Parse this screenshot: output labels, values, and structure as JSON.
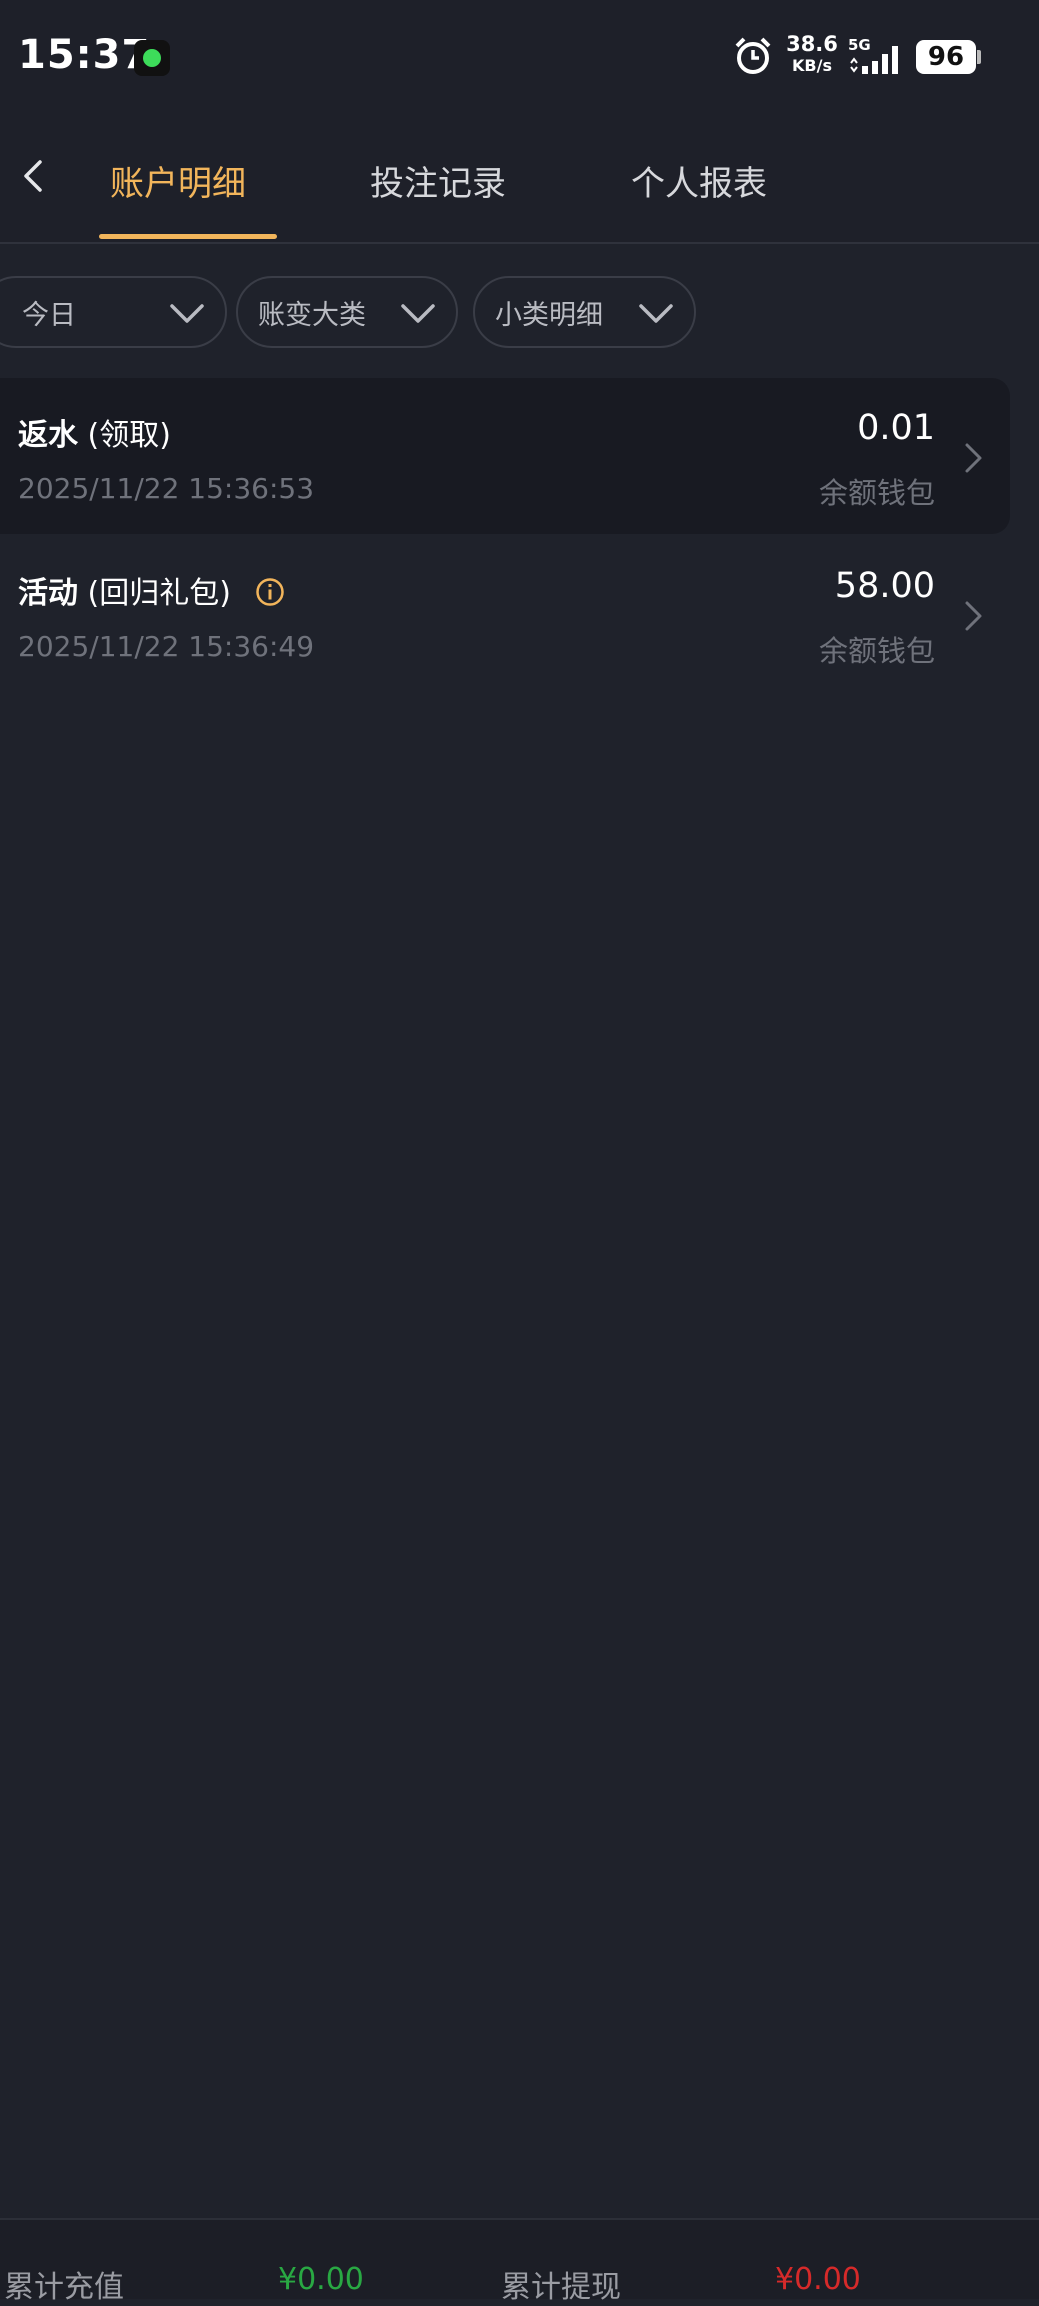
{
  "status_bar": {
    "time": "15:37",
    "net_speed_value": "38.6",
    "net_speed_unit": "KB/s",
    "network": "5G",
    "battery": "96"
  },
  "nav": {
    "tabs": [
      {
        "label": "账户明细",
        "active": true
      },
      {
        "label": "投注记录",
        "active": false
      },
      {
        "label": "个人报表",
        "active": false
      }
    ]
  },
  "filters": [
    {
      "label": "今日"
    },
    {
      "label": "账变大类"
    },
    {
      "label": "小类明细"
    }
  ],
  "records": [
    {
      "type": "返水",
      "detail": "(领取)",
      "time": "2025/11/22 15:36:53",
      "amount": "0.01",
      "wallet": "余额钱包",
      "has_info": false
    },
    {
      "type": "活动",
      "detail": "(回归礼包)",
      "time": "2025/11/22 15:36:49",
      "amount": "58.00",
      "wallet": "余额钱包",
      "has_info": true
    }
  ],
  "footer": {
    "deposit_label": "累计充值",
    "deposit_value": "¥0.00",
    "withdraw_label": "累计提现",
    "withdraw_value": "¥0.00"
  },
  "colors": {
    "accent": "#f2b55b",
    "background": "#1f222b",
    "deposit": "#29a843",
    "withdraw": "#d62a2a"
  }
}
